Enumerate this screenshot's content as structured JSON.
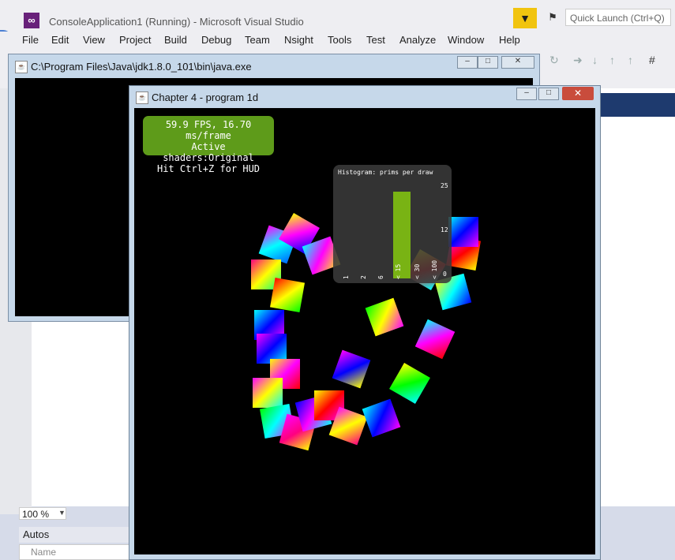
{
  "vs": {
    "title": "ConsoleApplication1 (Running) - Microsoft Visual Studio",
    "quick_launch_placeholder": "Quick Launch (Ctrl+Q)",
    "menu": [
      "File",
      "Edit",
      "View",
      "Project",
      "Build",
      "Debug",
      "Team",
      "Nsight",
      "Tools",
      "Test",
      "Analyze",
      "Window",
      "Help"
    ],
    "zoom": "100 %",
    "autos_title": "Autos",
    "autos_name_col": "Name"
  },
  "console_window": {
    "title": "C:\\Program Files\\Java\\jdk1.8.0_101\\bin\\java.exe"
  },
  "game_window": {
    "title": "Chapter 4 - program 1d",
    "hud": {
      "line1": "59.9 FPS, 16.70 ms/frame",
      "line2": "Active shaders:Original",
      "line3": "Hit Ctrl+Z for HUD"
    },
    "histogram": {
      "title": "Histogram: prims per draw",
      "y_top": "25",
      "y_mid": "12",
      "y_bottom": "0",
      "bins": [
        "1",
        "2",
        "6",
        "< 15",
        "< 30",
        "< 100"
      ],
      "values": [
        0,
        0,
        0,
        25,
        0,
        0
      ],
      "bar_color": "#79b314"
    }
  }
}
